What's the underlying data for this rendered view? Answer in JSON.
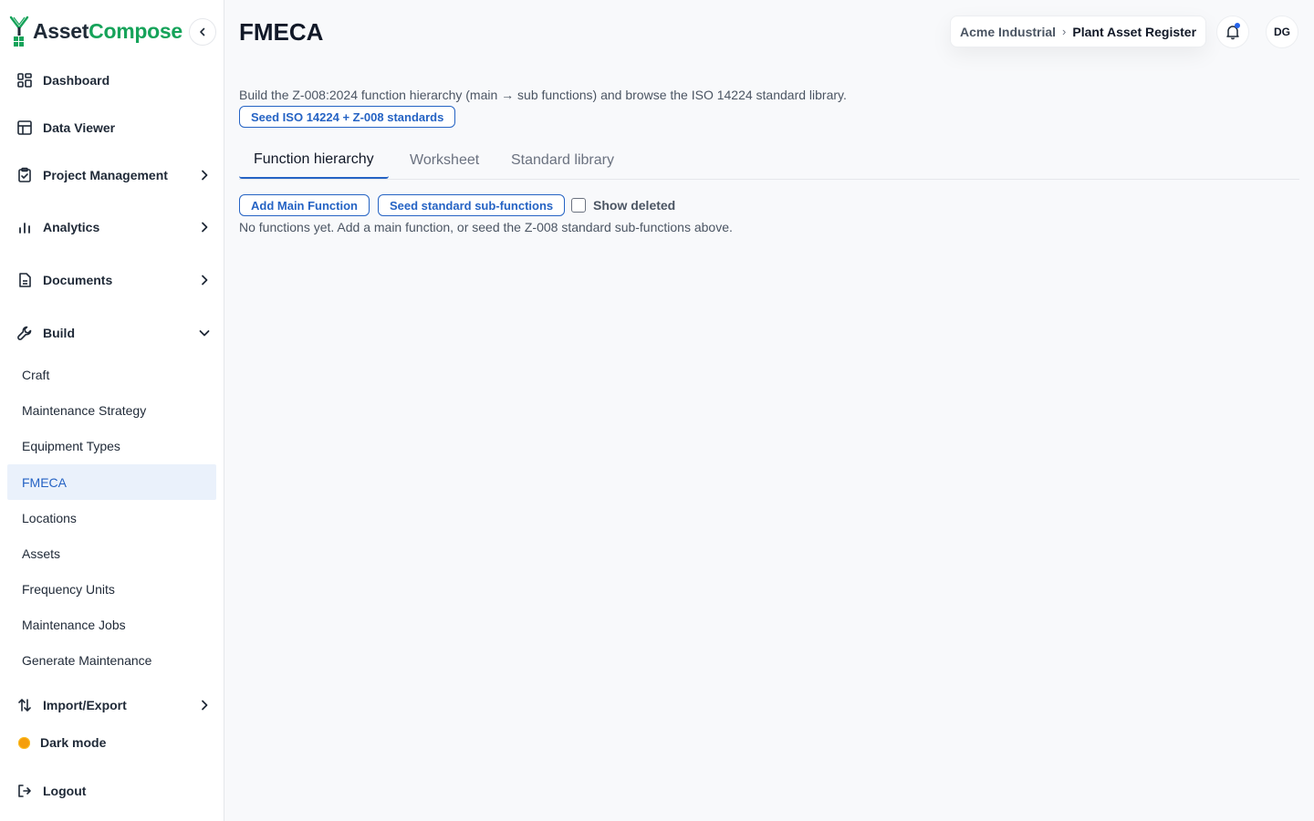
{
  "brand": {
    "part1": "Asset",
    "part2": "Compose"
  },
  "sidebar": {
    "items": [
      {
        "label": "Dashboard",
        "icon": "dashboard-icon"
      },
      {
        "label": "Data Viewer",
        "icon": "table-icon"
      },
      {
        "label": "Project Management",
        "icon": "clipboard-icon"
      },
      {
        "label": "Analytics",
        "icon": "bar-chart-icon"
      },
      {
        "label": "Documents",
        "icon": "document-icon"
      },
      {
        "label": "Build",
        "icon": "wrench-icon"
      }
    ],
    "build_sub": [
      "Craft",
      "Maintenance Strategy",
      "Equipment Types",
      "FMECA",
      "Locations",
      "Assets",
      "Frequency Units",
      "Maintenance Jobs",
      "Generate Maintenance"
    ],
    "active_sub": "FMECA",
    "import_export": "Import/Export",
    "dark_mode": "Dark mode",
    "logout": "Logout"
  },
  "header": {
    "title": "FMECA",
    "breadcrumb": {
      "org": "Acme Industrial",
      "separator": "›",
      "project": "Plant Asset Register"
    },
    "avatar_initials": "DG"
  },
  "main": {
    "description": "Build the Z-008:2024 function hierarchy (main → sub functions) and browse the ISO 14224 standard library.",
    "seed_button": "Seed ISO 14224 + Z-008 standards",
    "tabs": [
      "Function hierarchy",
      "Worksheet",
      "Standard library"
    ],
    "active_tab": "Function hierarchy",
    "add_main_button": "Add Main Function",
    "seed_sub_button": "Seed standard sub-functions",
    "show_deleted_label": "Show deleted",
    "show_deleted_checked": false,
    "empty_message": "No functions yet. Add a main function, or seed the Z-008 standard sub-functions above."
  },
  "colors": {
    "accent": "#2563c4",
    "brand_green": "#16a35a",
    "active_bg": "#eaf1fb",
    "dark_mode_dot": "#f59e0b"
  }
}
